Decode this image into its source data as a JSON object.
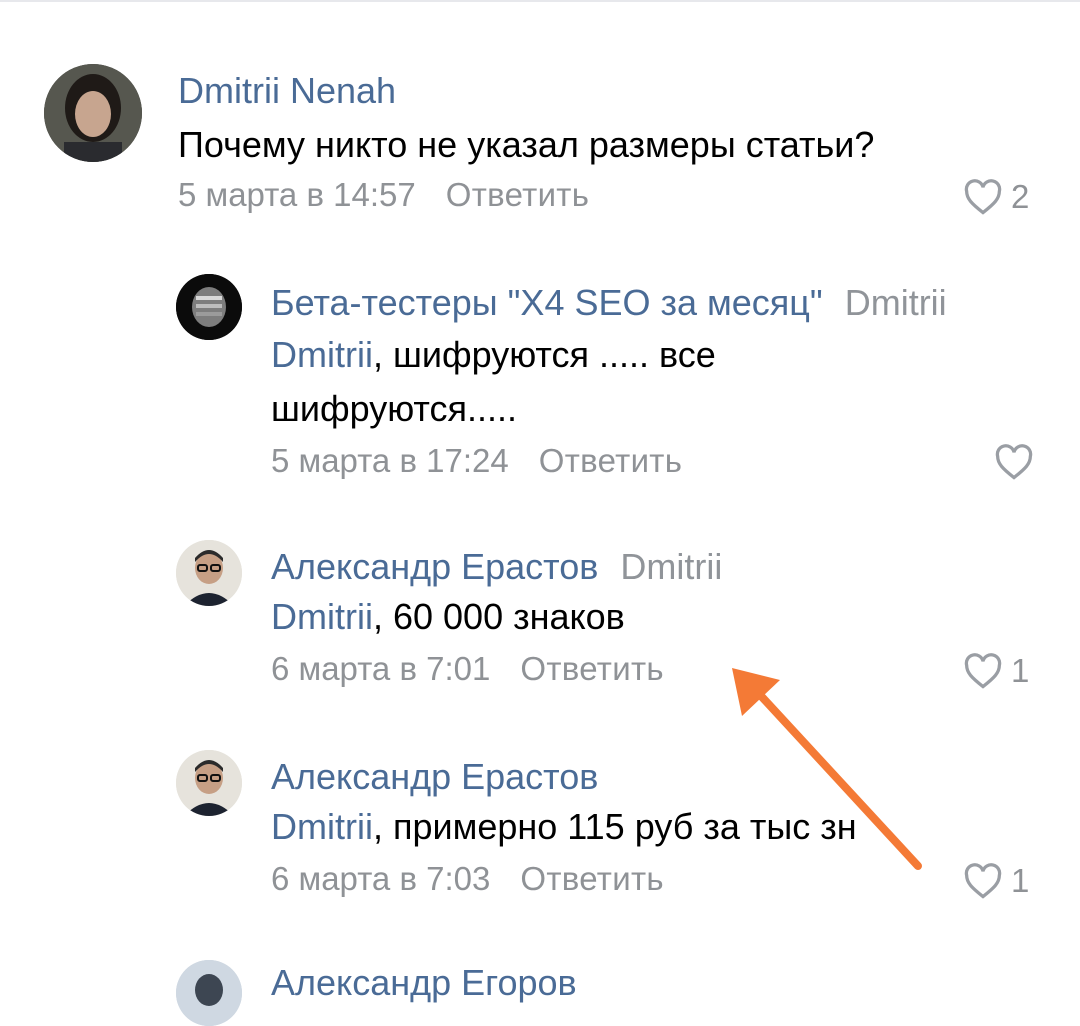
{
  "comments": [
    {
      "author": "Dmitrii Nenah",
      "text": "Почему никто не указал размеры статьи?",
      "date": "5 марта в 14:57",
      "reply_label": "Ответить",
      "likes": "2"
    },
    {
      "author": "Бета-тестеры \"Х4 SEO за месяц\"",
      "reply_to": "Dmitrii",
      "mention": "Dmitrii",
      "text_line1": ", шифруются ..... все",
      "text_line2": "шифруются.....",
      "date": "5 марта в 17:24",
      "reply_label": "Ответить",
      "likes": ""
    },
    {
      "author": "Александр Ерастов",
      "reply_to": "Dmitrii",
      "mention": "Dmitrii",
      "text": ", 60 000 знаков",
      "date": "6 марта в 7:01",
      "reply_label": "Ответить",
      "likes": "1"
    },
    {
      "author": "Александр Ерастов",
      "mention": "Dmitrii",
      "text": ", примерно 115 руб за тыс зн",
      "date": "6 марта в 7:03",
      "reply_label": "Ответить",
      "likes": "1"
    },
    {
      "author": "Александр Егоров"
    }
  ],
  "colors": {
    "author": "#4a6b96",
    "meta": "#8f9296",
    "arrow": "#f47a36"
  },
  "icons": [
    "heart-outline-icon",
    "arrow-annotation"
  ]
}
